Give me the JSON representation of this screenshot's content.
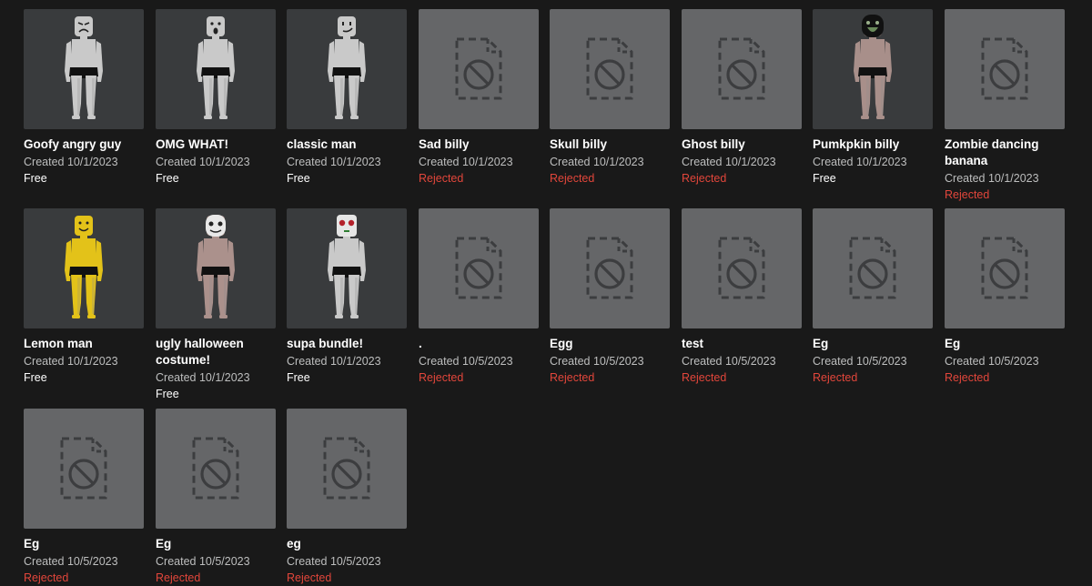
{
  "colors": {
    "page_bg": "#191919",
    "avatar_thumb_bg": "#393b3d",
    "placeholder_thumb_bg": "#656668",
    "free": "#ffffff",
    "rejected": "#e2463b",
    "meta": "#bdbebe"
  },
  "items": [
    {
      "name": "Goofy angry guy",
      "created": "Created 10/1/2023",
      "status": "Free",
      "thumb": "avatar",
      "skin": "#c9c9c9",
      "face": "angry"
    },
    {
      "name": "OMG WHAT!",
      "created": "Created 10/1/2023",
      "status": "Free",
      "thumb": "avatar",
      "skin": "#c9c9c9",
      "face": "surprised"
    },
    {
      "name": "classic man",
      "created": "Created 10/1/2023",
      "status": "Free",
      "thumb": "avatar",
      "skin": "#c9c9c9",
      "face": "smirk"
    },
    {
      "name": "Sad billy",
      "created": "Created 10/1/2023",
      "status": "Rejected",
      "thumb": "placeholder"
    },
    {
      "name": "Skull billy",
      "created": "Created 10/1/2023",
      "status": "Rejected",
      "thumb": "placeholder"
    },
    {
      "name": "Ghost billy",
      "created": "Created 10/1/2023",
      "status": "Rejected",
      "thumb": "placeholder"
    },
    {
      "name": "Pumkpkin billy",
      "created": "Created 10/1/2023",
      "status": "Free",
      "thumb": "avatar",
      "skin": "#a88f8a",
      "face": "pumpkin"
    },
    {
      "name": "Zombie dancing banana",
      "created": "Created 10/1/2023",
      "status": "Rejected",
      "thumb": "placeholder"
    },
    {
      "name": "Lemon man",
      "created": "Created 10/1/2023",
      "status": "Free",
      "thumb": "avatar",
      "skin": "#e3c219",
      "face": "smile"
    },
    {
      "name": "ugly halloween costume!",
      "created": "Created 10/1/2023",
      "status": "Free",
      "thumb": "avatar",
      "skin": "#ab918c",
      "face": "mask"
    },
    {
      "name": "supa bundle!",
      "created": "Created 10/1/2023",
      "status": "Free",
      "thumb": "avatar",
      "skin": "#c9c9c9",
      "face": "roses"
    },
    {
      "name": ".",
      "created": "Created 10/5/2023",
      "status": "Rejected",
      "thumb": "placeholder"
    },
    {
      "name": "Egg",
      "created": "Created 10/5/2023",
      "status": "Rejected",
      "thumb": "placeholder"
    },
    {
      "name": "test",
      "created": "Created 10/5/2023",
      "status": "Rejected",
      "thumb": "placeholder"
    },
    {
      "name": "Eg",
      "created": "Created 10/5/2023",
      "status": "Rejected",
      "thumb": "placeholder"
    },
    {
      "name": "Eg",
      "created": "Created 10/5/2023",
      "status": "Rejected",
      "thumb": "placeholder"
    },
    {
      "name": "Eg",
      "created": "Created 10/5/2023",
      "status": "Rejected",
      "thumb": "placeholder"
    },
    {
      "name": "Eg",
      "created": "Created 10/5/2023",
      "status": "Rejected",
      "thumb": "placeholder"
    },
    {
      "name": "eg",
      "created": "Created 10/5/2023",
      "status": "Rejected",
      "thumb": "placeholder"
    }
  ]
}
